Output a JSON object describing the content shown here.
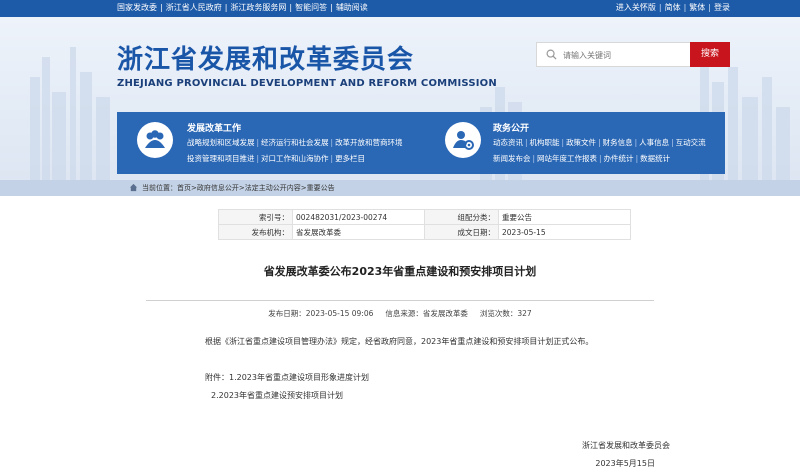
{
  "topbar": {
    "left_links": [
      "国家发改委",
      "浙江省人民政府",
      "浙江政务服务网",
      "智能问答",
      "辅助阅读"
    ],
    "right_links": [
      "进入关怀版",
      "简体",
      "繁体",
      "登录"
    ]
  },
  "header": {
    "title_cn": "浙江省发展和改革委员会",
    "title_en": "ZHEJIANG PROVINCIAL DEVELOPMENT AND REFORM COMMISSION",
    "search": {
      "placeholder": "请输入关键词",
      "button": "搜索"
    }
  },
  "nav": {
    "left": {
      "icon": "people-icon",
      "title": "发展改革工作",
      "row1": [
        "战略规划和区域发展",
        "经济运行和社会发展",
        "改革开放和营商环境"
      ],
      "row2": [
        "投资管理和项目推进",
        "对口工作和山海协作",
        "更多栏目"
      ]
    },
    "right": {
      "icon": "user-settings-icon",
      "title": "政务公开",
      "row1": [
        "动态资讯",
        "机构职能",
        "政策文件",
        "财务信息",
        "人事信息",
        "互动交流"
      ],
      "row2": [
        "新闻发布会",
        "网站年度工作报表",
        "办件统计",
        "数据统计"
      ]
    }
  },
  "breadcrumb": {
    "text": "当前位置：首页>政府信息公开>法定主动公开内容>重要公告"
  },
  "meta": {
    "index_label": "索引号：",
    "index_value": "002482031/2023-00274",
    "category_label": "组配分类：",
    "category_value": "重要公告",
    "publisher_label": "发布机构：",
    "publisher_value": "省发展改革委",
    "date_label": "成文日期：",
    "date_value": "2023-05-15"
  },
  "article": {
    "title": "省发展改革委公布2023年省重点建设和预安排项目计划",
    "publish_date": "发布日期：2023-05-15 09:06",
    "source": "信息来源：省发展改革委",
    "views": "浏览次数：327",
    "paragraph": "根据《浙江省重点建设项目管理办法》规定，经省政府同意，2023年省重点建设和预安排项目计划正式公布。",
    "attachment1": "附件：1.2023年省重点建设项目形象进度计划",
    "attachment2": "2.2023年省重点建设预安排项目计划",
    "signature": "浙江省发展和改革委员会",
    "sign_date": "2023年5月15日"
  },
  "colors": {
    "brand_blue": "#1d5aa8",
    "nav_blue": "#2a67b5",
    "search_red": "#c8151d",
    "crumb_bg": "#c3d2e6"
  }
}
